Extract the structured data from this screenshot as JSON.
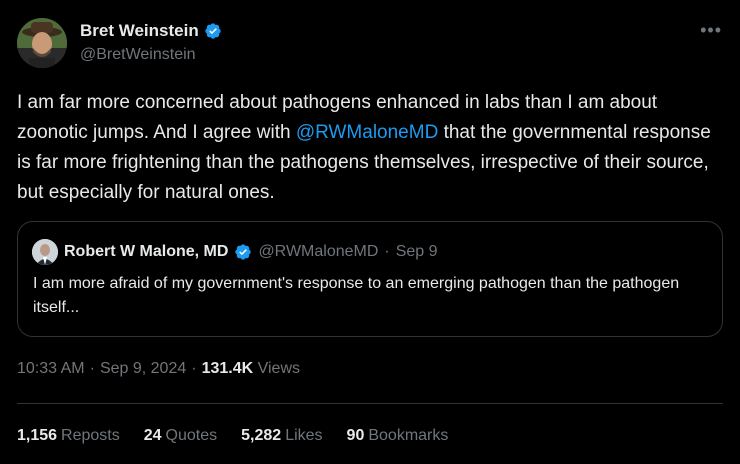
{
  "author": {
    "name": "Bret Weinstein",
    "handle": "@BretWeinstein",
    "verified_icon": "verified-badge-icon"
  },
  "more_label": "•••",
  "tweet": {
    "text_before": "I am far more concerned about pathogens enhanced in labs than I am about zoonotic jumps. And I agree with ",
    "mention": "@RWMaloneMD",
    "text_after": " that the governmental response is far more frightening than the pathogens themselves, irrespective of their source, but especially for natural ones."
  },
  "quote": {
    "name": "Robert W Malone, MD",
    "handle": "@RWMaloneMD",
    "sep": "·",
    "date": "Sep 9",
    "text": "I am more afraid of my government's response to an emerging pathogen than the pathogen itself..."
  },
  "meta": {
    "time": "10:33 AM",
    "sep1": "·",
    "date": "Sep 9, 2024",
    "sep2": "·",
    "views_count": "131.4K",
    "views_label": "Views"
  },
  "stats": [
    {
      "count": "1,156",
      "label": "Reposts"
    },
    {
      "count": "24",
      "label": "Quotes"
    },
    {
      "count": "5,282",
      "label": "Likes"
    },
    {
      "count": "90",
      "label": "Bookmarks"
    }
  ],
  "colors": {
    "background": "#000000",
    "text": "#e7e9ea",
    "muted": "#71767b",
    "accent": "#1d9bf0",
    "border": "#2f3336"
  }
}
